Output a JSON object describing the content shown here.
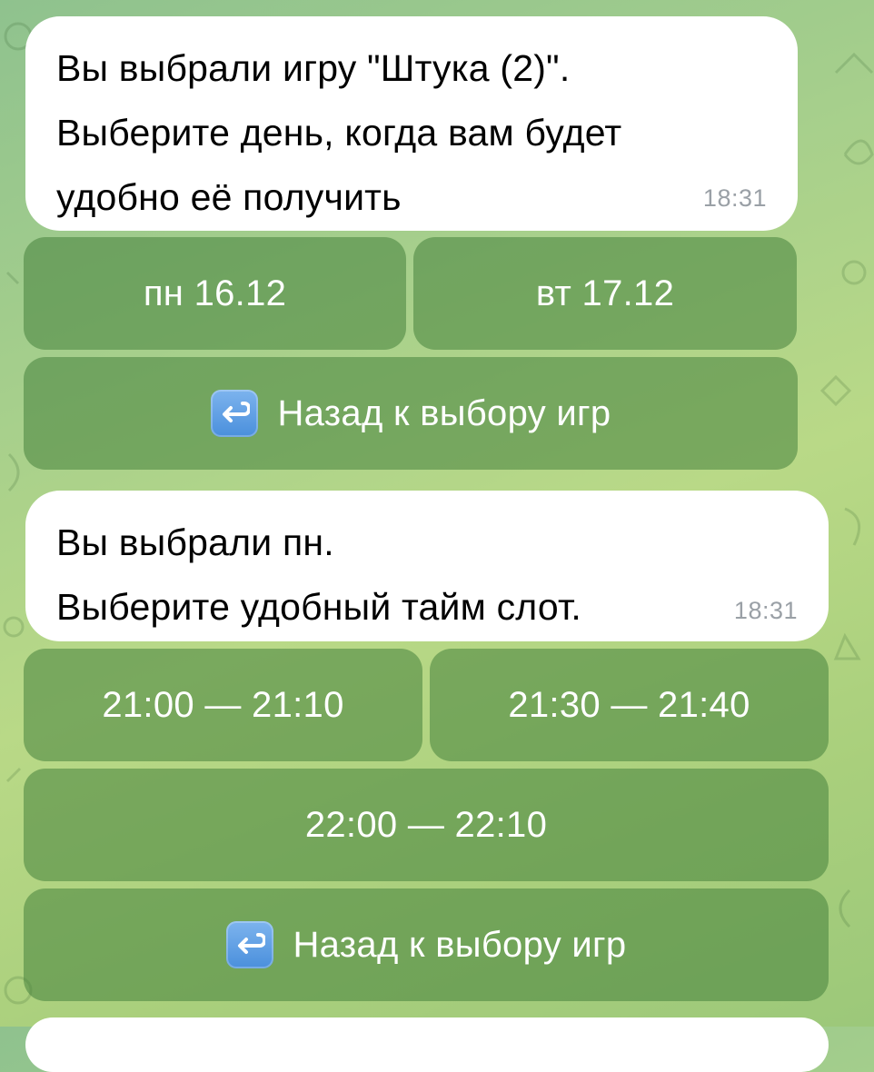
{
  "messages": [
    {
      "text": "Вы выбрали игру \"Штука (2)\".\nВыберите день, когда вам будет\nудобно её получить",
      "time": "18:31",
      "buttons": [
        [
          "пн 16.12",
          "вт 17.12"
        ],
        [
          "Назад к выбору игр"
        ]
      ]
    },
    {
      "text": "Вы выбрали пн.\nВыберите удобный тайм слот.",
      "time": "18:31",
      "buttons": [
        [
          "21:00 — 21:10",
          "21:30 — 21:40"
        ],
        [
          "22:00 — 22:10"
        ],
        [
          "Назад к выбору игр"
        ]
      ]
    }
  ],
  "icons": {
    "back": "return-arrow-icon"
  },
  "colors": {
    "bubble": "#ffffff",
    "button_bg": "rgba(70,130,60,0.55)",
    "back_icon": "#4a8fdc"
  }
}
